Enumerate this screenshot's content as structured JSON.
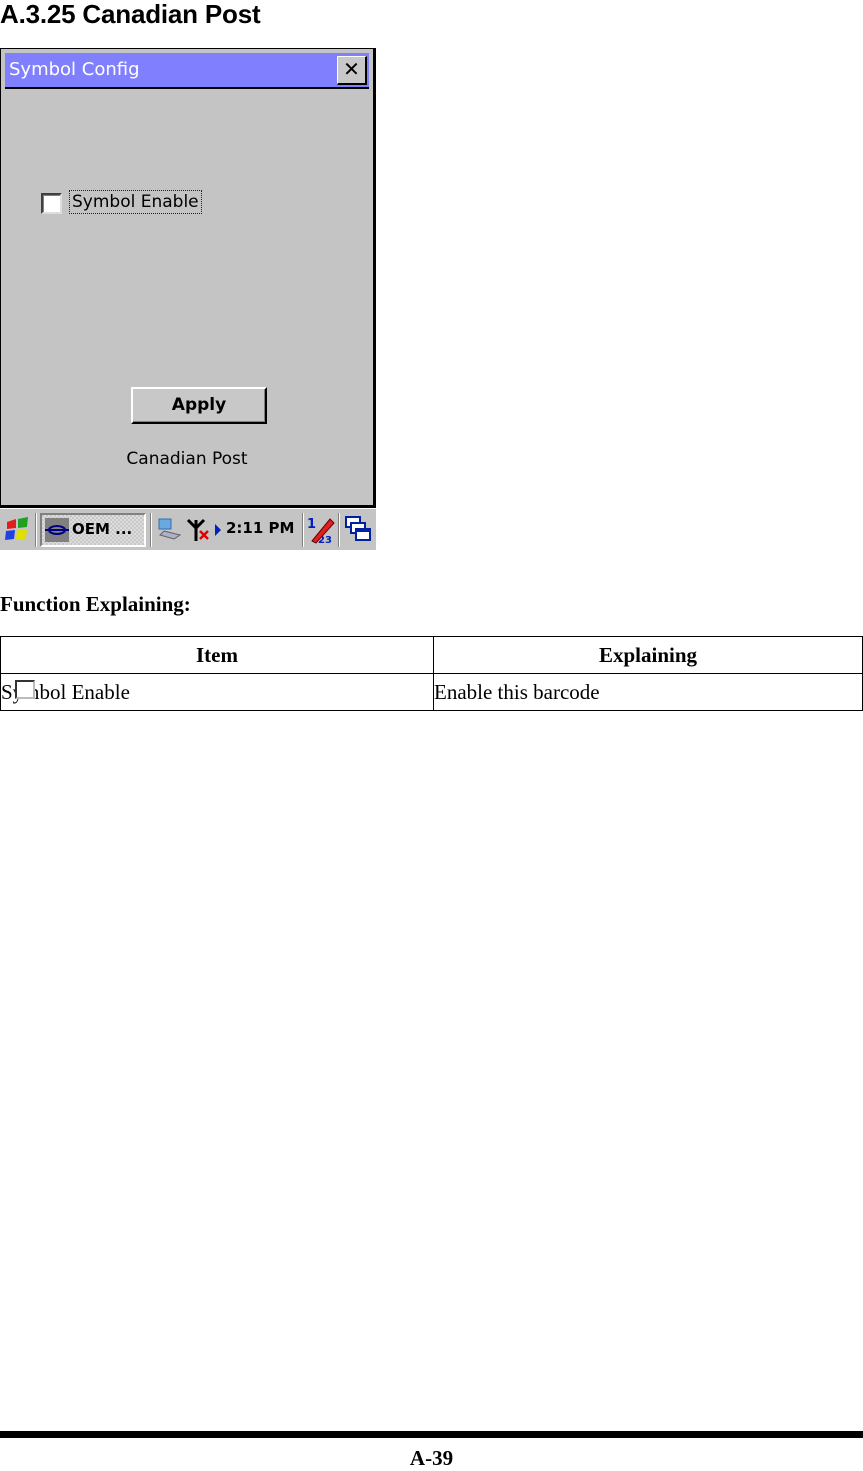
{
  "section_title": "A.3.25 Canadian Post",
  "dialog": {
    "title": "Symbol Config",
    "close_icon": "close-icon",
    "checkbox": {
      "label": "Symbol Enable",
      "checked": false
    },
    "apply_label": "Apply",
    "symbol_name": "Canadian Post",
    "title_color": "#8080ff"
  },
  "taskbar": {
    "start_icon": "windows-flag-icon",
    "task_label": "OEM ...",
    "task_icon": "oem-app-icon",
    "tray_icons": [
      "network-icon",
      "antenna-disconnected-icon",
      "arrow-right-icon"
    ],
    "clock": "2:11 PM",
    "input_icon": "input-panel-icon",
    "desktop_icon": "windows-switch-icon"
  },
  "function_heading": "Function Explaining:",
  "table": {
    "headers": [
      "Item",
      "Explaining"
    ],
    "rows": [
      {
        "item": "Symbol Enable",
        "explaining": "Enable this barcode",
        "icon": "checkbox-icon"
      }
    ]
  },
  "page_number": "A-39"
}
